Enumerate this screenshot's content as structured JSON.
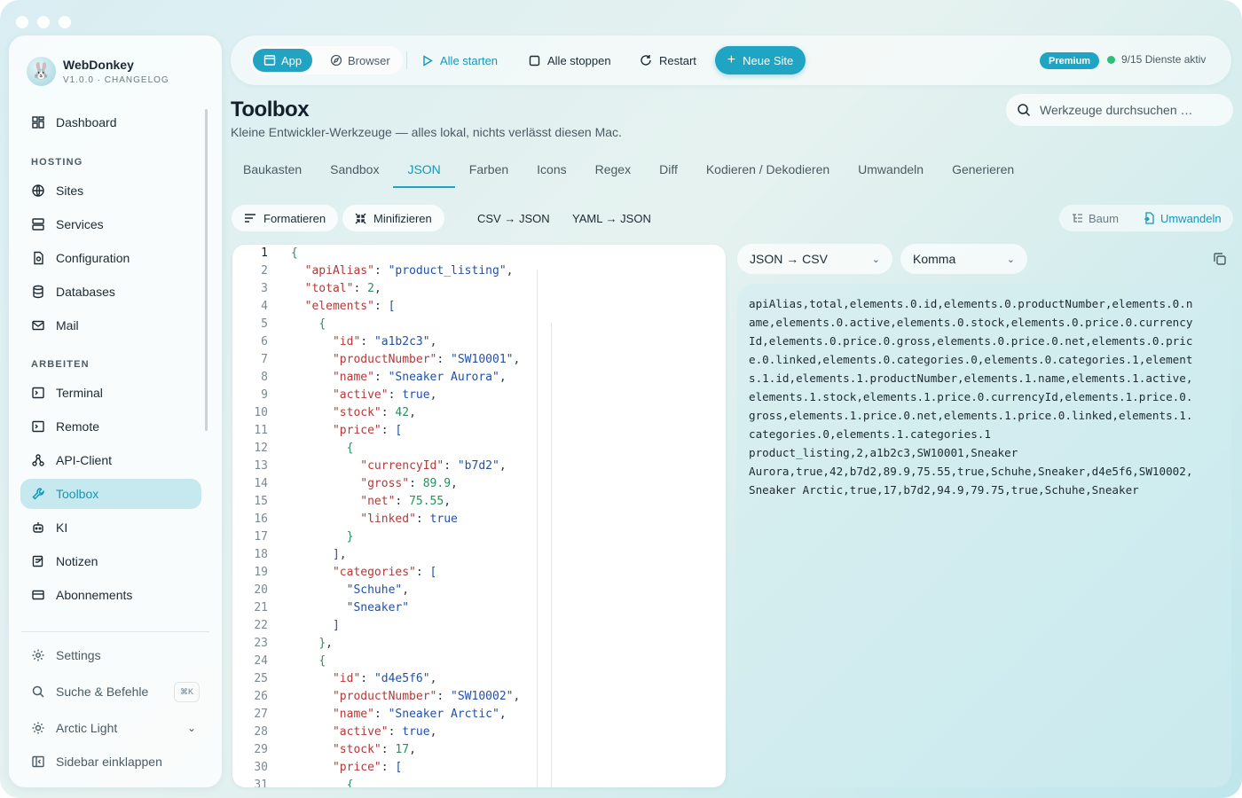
{
  "app": {
    "name": "WebDonkey",
    "version": "V1.0.0 · CHANGELOG"
  },
  "sidebar": {
    "top": [
      {
        "label": "Dashboard",
        "icon": "dashboard-icon"
      }
    ],
    "hosting_label": "HOSTING",
    "hosting": [
      {
        "label": "Sites",
        "icon": "globe-icon"
      },
      {
        "label": "Services",
        "icon": "server-icon"
      },
      {
        "label": "Configuration",
        "icon": "config-file-icon"
      },
      {
        "label": "Databases",
        "icon": "database-icon"
      },
      {
        "label": "Mail",
        "icon": "mail-icon"
      }
    ],
    "arbeiten_label": "ARBEITEN",
    "arbeiten": [
      {
        "label": "Terminal",
        "icon": "terminal-icon"
      },
      {
        "label": "Remote",
        "icon": "remote-icon"
      },
      {
        "label": "API-Client",
        "icon": "api-icon"
      },
      {
        "label": "Toolbox",
        "icon": "wrench-icon",
        "active": true
      },
      {
        "label": "KI",
        "icon": "robot-icon"
      },
      {
        "label": "Notizen",
        "icon": "notes-icon"
      },
      {
        "label": "Abonnements",
        "icon": "card-icon"
      }
    ],
    "bottom": [
      {
        "label": "Settings",
        "icon": "gear-icon"
      },
      {
        "label": "Suche & Befehle",
        "icon": "search-icon",
        "shortcut": "⌘K"
      },
      {
        "label": "Arctic Light",
        "icon": "sun-icon"
      },
      {
        "label": "Sidebar einklappen",
        "icon": "collapse-sidebar-icon"
      }
    ]
  },
  "topbar": {
    "app_label": "App",
    "browser_label": "Browser",
    "start_all": "Alle starten",
    "stop_all": "Alle stoppen",
    "restart": "Restart",
    "new_site": "Neue Site",
    "premium": "Premium",
    "services_status": "9/15 Dienste aktiv",
    "accent_color": "#1fa4c4",
    "status_color": "#2bbf7a"
  },
  "page": {
    "title": "Toolbox",
    "subtitle": "Kleine Entwickler-Werkzeuge — alles lokal, nichts verlässt diesen Mac.",
    "search_placeholder": "Werkzeuge durchsuchen …"
  },
  "tabs": [
    "Baukasten",
    "Sandbox",
    "JSON",
    "Farben",
    "Icons",
    "Regex",
    "Diff",
    "Kodieren / Dekodieren",
    "Umwandeln",
    "Generieren"
  ],
  "active_tab": "JSON",
  "json_tools": {
    "format": "Formatieren",
    "minify": "Minifizieren",
    "csv_json": "CSV → JSON",
    "yaml_json": "YAML → JSON",
    "tree": "Baum",
    "convert": "Umwandeln"
  },
  "editor": {
    "current_line": 1,
    "lines": [
      "{",
      "  \"apiAlias\": \"product_listing\",",
      "  \"total\": 2,",
      "  \"elements\": [",
      "    {",
      "      \"id\": \"a1b2c3\",",
      "      \"productNumber\": \"SW10001\",",
      "      \"name\": \"Sneaker Aurora\",",
      "      \"active\": true,",
      "      \"stock\": 42,",
      "      \"price\": [",
      "        {",
      "          \"currencyId\": \"b7d2\",",
      "          \"gross\": 89.9,",
      "          \"net\": 75.55,",
      "          \"linked\": true",
      "        }",
      "      ],",
      "      \"categories\": [",
      "        \"Schuhe\",",
      "        \"Sneaker\"",
      "      ]",
      "    },",
      "    {",
      "      \"id\": \"d4e5f6\",",
      "      \"productNumber\": \"SW10002\",",
      "      \"name\": \"Sneaker Arctic\",",
      "      \"active\": true,",
      "      \"stock\": 17,",
      "      \"price\": [",
      "        {"
    ]
  },
  "converter": {
    "mode": "JSON → CSV",
    "delimiter": "Komma",
    "output_lines": [
      "apiAlias,total,elements.0.id,elements.0.productNumber,elements.0.n",
      "ame,elements.0.active,elements.0.stock,elements.0.price.0.currency",
      "Id,elements.0.price.0.gross,elements.0.price.0.net,elements.0.pric",
      "e.0.linked,elements.0.categories.0,elements.0.categories.1,element",
      "s.1.id,elements.1.productNumber,elements.1.name,elements.1.active,",
      "elements.1.stock,elements.1.price.0.currencyId,elements.1.price.0.",
      "gross,elements.1.price.0.net,elements.1.price.0.linked,elements.1.",
      "categories.0,elements.1.categories.1",
      "product_listing,2,a1b2c3,SW10001,Sneaker",
      "Aurora,true,42,b7d2,89.9,75.55,true,Schuhe,Sneaker,d4e5f6,SW10002,",
      "Sneaker Arctic,true,17,b7d2,94.9,79.75,true,Schuhe,Sneaker"
    ]
  }
}
